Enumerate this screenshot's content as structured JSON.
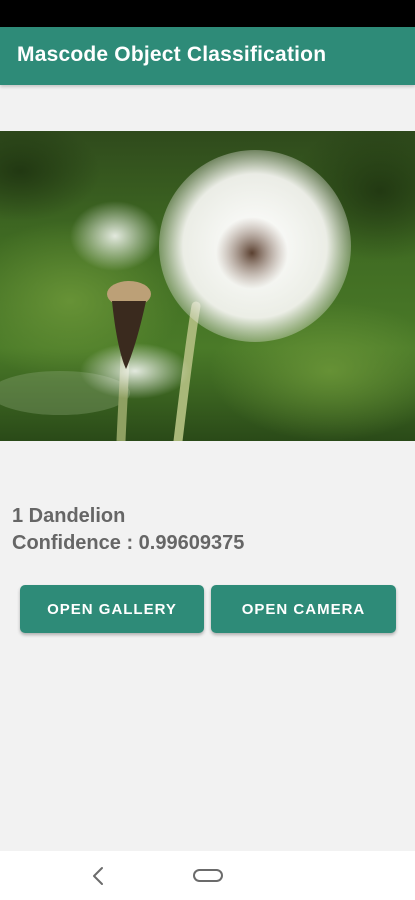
{
  "app_bar": {
    "title": "Mascode Object Classification",
    "color": "#2e8b78"
  },
  "image": {
    "subject": "dandelion photo"
  },
  "result": {
    "label": "1 Dandelion",
    "confidence": "Confidence : 0.99609375"
  },
  "buttons": {
    "gallery_label": "OPEN GALLERY",
    "camera_label": "OPEN CAMERA"
  },
  "nav": {
    "back_icon": "back-chevron-icon",
    "home_icon": "home-pill-icon"
  }
}
